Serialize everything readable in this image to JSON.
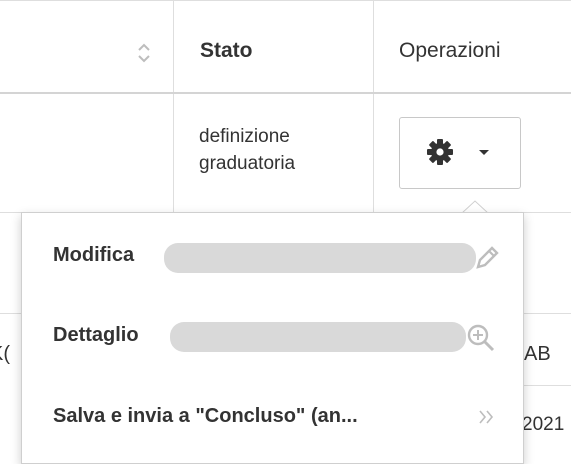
{
  "table": {
    "header": {
      "stato": "Stato",
      "operazioni": "Operazioni",
      "sort_icon": "sort-icon"
    },
    "row": {
      "stato_line1": "definizione",
      "stato_line2": "graduatoria"
    },
    "gear_button": {
      "icon": "gear-icon",
      "caret": "caret-down-icon"
    },
    "background_partial": {
      "left_fragment": "K(",
      "right_fragment": "AB",
      "year_fragment": "2021"
    }
  },
  "dropdown": {
    "items": [
      {
        "label": "Modifica",
        "trailing": "",
        "icon": "pencil-icon"
      },
      {
        "label": "Dettaglio",
        "trailing": "",
        "icon": "zoom-in-icon"
      },
      {
        "label": "Salva e invia a \"Concluso\" (an...",
        "trailing": "",
        "icon": "double-chevron-right-icon"
      }
    ]
  },
  "colors": {
    "border": "#dedede",
    "text": "#333333",
    "redaction": "#d9d9d9",
    "icon_muted": "#bdbdbd"
  }
}
